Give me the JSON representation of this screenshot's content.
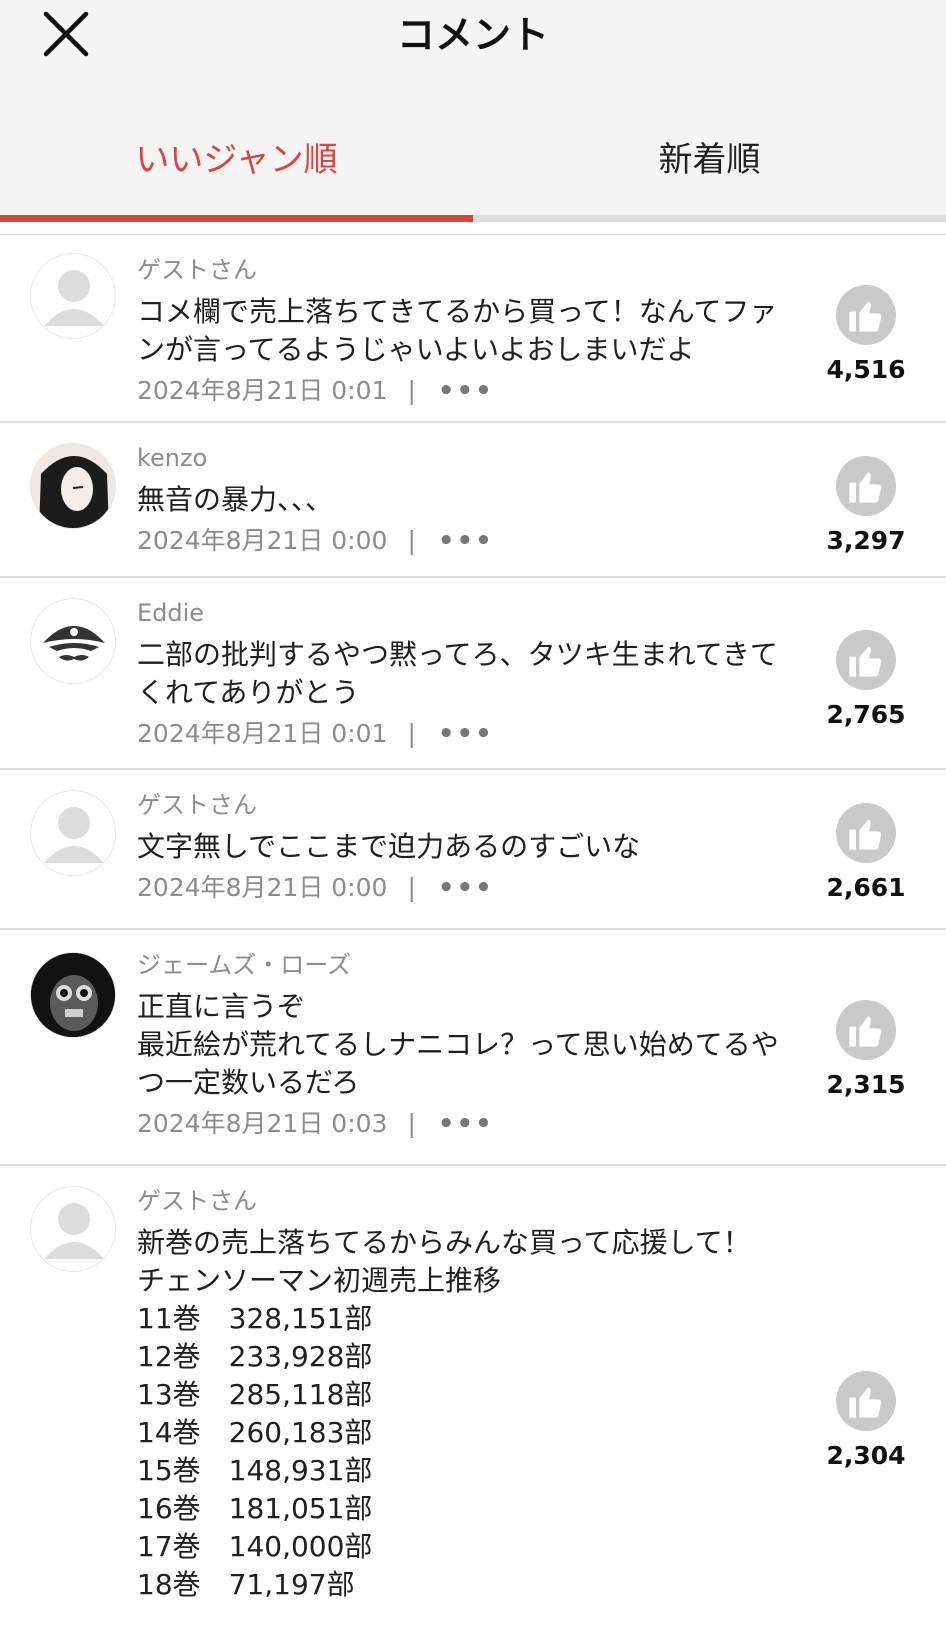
{
  "header": {
    "title": "コメント"
  },
  "tabs": [
    {
      "label": "いいジャン順",
      "active": true
    },
    {
      "label": "新着順",
      "active": false
    }
  ],
  "comments": [
    {
      "author": "ゲストさん",
      "avatar": "guest-avatar-icon",
      "text": "コメ欄で売上落ちてきてるから買って！なんてファンが言ってるようじゃいよいよおしまいだよ",
      "date": "2024年8月21日 0:01",
      "likes": "4,516"
    },
    {
      "author": "kenzo",
      "avatar": "user-avatar",
      "text": "無音の暴力、、、",
      "date": "2024年8月21日 0:00",
      "likes": "3,297"
    },
    {
      "author": "Eddie",
      "avatar": "pirate-avatar-icon",
      "text": "二部の批判するやつ黙ってろ、タツキ生まれてきてくれてありがとう",
      "date": "2024年8月21日 0:01",
      "likes": "2,765"
    },
    {
      "author": "ゲストさん",
      "avatar": "guest-avatar-icon",
      "text": "文字無しでここまで迫力あるのすごいな",
      "date": "2024年8月21日 0:00",
      "likes": "2,661"
    },
    {
      "author": "ジェームズ・ローズ",
      "avatar": "user-avatar",
      "text": "正直に言うぞ\n最近絵が荒れてるしナニコレ？って思い始めてるやつ一定数いるだろ",
      "date": "2024年8月21日 0:03",
      "likes": "2,315"
    },
    {
      "author": "ゲストさん",
      "avatar": "guest-avatar-icon",
      "text": "新巻の売上落ちてるからみんな買って応援して！\nチェンソーマン初週売上推移\n11巻　328,151部\n12巻　233,928部\n13巻　285,118部\n14巻　260,183部\n15巻　148,931部\n16巻　181,051部\n17巻　140,000部\n18巻　71,197部",
      "date": "",
      "likes": "2,304"
    }
  ],
  "meta": {
    "separator": "|",
    "more": "•••"
  },
  "colors": {
    "accent": "#d8443e",
    "like_button": "#c9c9c9"
  }
}
